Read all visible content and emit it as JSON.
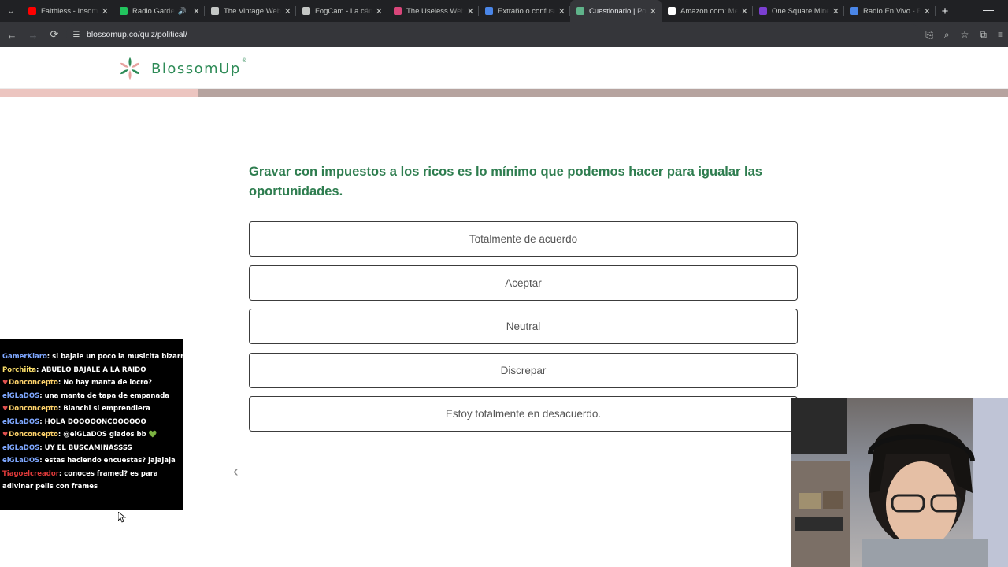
{
  "browser": {
    "tabs": [
      {
        "title": "Faithless - Insomnia",
        "favicon_color": "#ff0000",
        "active": false,
        "audio": false
      },
      {
        "title": "Radio Garden",
        "favicon_color": "#22c55e",
        "active": false,
        "audio": true
      },
      {
        "title": "The Vintage Web",
        "favicon_color": "#c4c7c5",
        "active": false,
        "audio": false
      },
      {
        "title": "FogCam - La cámara",
        "favicon_color": "#c4c7c5",
        "active": false,
        "audio": false
      },
      {
        "title": "The Useless Web",
        "favicon_color": "#d9467a",
        "active": false,
        "audio": false
      },
      {
        "title": "Extraño o confuso",
        "favicon_color": "#4a86e8",
        "active": false,
        "audio": false
      },
      {
        "title": "Cuestionario | Political",
        "favicon_color": "#5fb38a",
        "active": true,
        "audio": false
      },
      {
        "title": "Amazon.com: Mercado",
        "favicon_color": "#ffffff",
        "active": false,
        "audio": false
      },
      {
        "title": "One Square Minesweeper",
        "favicon_color": "#7b3fd1",
        "active": false,
        "audio": false
      },
      {
        "title": "Radio En Vivo - Radio",
        "favicon_color": "#4a86e8",
        "active": false,
        "audio": false
      }
    ],
    "url": "blossomup.co/quiz/political/"
  },
  "site": {
    "brand_name": "BlossomUp",
    "brand_mark": "®",
    "brand_color": "#2e8b57"
  },
  "quiz": {
    "progress": 0.196,
    "question": "Gravar con impuestos a los ricos es lo mínimo que podemos hacer para igualar las oportunidades.",
    "options": [
      "Totalmente de acuerdo",
      "Aceptar",
      "Neutral",
      "Discrepar",
      "Estoy totalmente en desacuerdo."
    ],
    "back_icon": "chevron-left-icon"
  },
  "chat": {
    "messages": [
      {
        "user": "GamerKiaro",
        "color": "#7ea7ff",
        "heart": false,
        "text": "si bajale un poco la musicita bizarrap"
      },
      {
        "user": "Porchiita",
        "color": "#ffe26b",
        "heart": false,
        "text": "ABUELO BAJALE A LA RAIDO"
      },
      {
        "user": "Donconcepto",
        "color": "#ffd36b",
        "heart": true,
        "text": "No hay manta de locro?"
      },
      {
        "user": "elGLaDOS",
        "color": "#7ea7ff",
        "heart": false,
        "text": "una manta de tapa de empanada"
      },
      {
        "user": "Donconcepto",
        "color": "#ffd36b",
        "heart": true,
        "text": "Bianchi si emprendiera"
      },
      {
        "user": "elGLaDOS",
        "color": "#7ea7ff",
        "heart": false,
        "text": "HOLA DOOOOONCOOOOOO"
      },
      {
        "user": "Donconcepto",
        "color": "#ffd36b",
        "heart": true,
        "text": "@elGLaDOS glados bb 💚"
      },
      {
        "user": "elGLaDOS",
        "color": "#7ea7ff",
        "heart": false,
        "text": "UY EL BUSCAMINASSSS"
      },
      {
        "user": "elGLaDOS",
        "color": "#7ea7ff",
        "heart": false,
        "text": "estas haciendo encuestas? jajajaja"
      },
      {
        "user": "Tiagoelcreador",
        "color": "#e03a3a",
        "heart": false,
        "text": "conoces framed? es para adivinar pelis con frames"
      }
    ]
  }
}
